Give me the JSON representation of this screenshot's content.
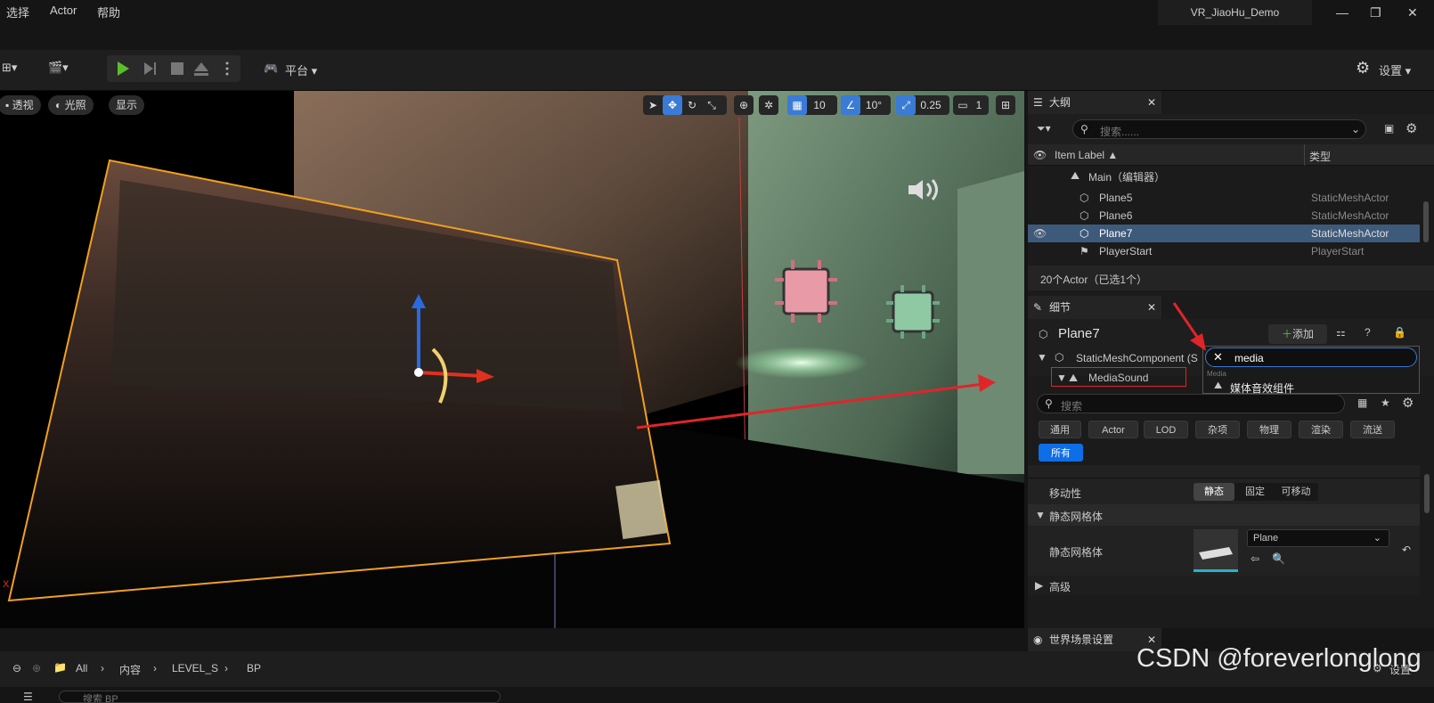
{
  "menu": [
    "选择",
    "Actor",
    "帮助"
  ],
  "project_name": "VR_JiaoHu_Demo",
  "toolbar": {
    "platform_label": "平台",
    "settings_label": "设置"
  },
  "viewport": {
    "view_mode": "透视",
    "lighting": "光照",
    "show": "显示",
    "grid_snap": "10",
    "rotation_snap": "10°",
    "scale_snap": "0.25",
    "camera_speed": "1",
    "axis_label": "X"
  },
  "outliner": {
    "tab_title": "大纲",
    "search_placeholder": "搜索......",
    "col_label": "Item Label ▲",
    "col_type": "类型",
    "level_row": "Main（编辑器）",
    "rows": [
      {
        "label": "Plane5",
        "type": "StaticMeshActor"
      },
      {
        "label": "Plane6",
        "type": "StaticMeshActor"
      },
      {
        "label": "Plane7",
        "type": "StaticMeshActor"
      },
      {
        "label": "PlayerStart",
        "type": "PlayerStart"
      }
    ],
    "status": "20个Actor（已选1个）"
  },
  "details": {
    "tab_title": "细节",
    "actor_name": "Plane7",
    "add_label": "添加",
    "component_root": "StaticMeshComponent (S",
    "component_child": "MediaSound",
    "popup_query": "media",
    "popup_category": "Media",
    "popup_item": "媒体音效组件",
    "search_placeholder": "搜索",
    "categories": [
      "通用",
      "Actor",
      "LOD",
      "杂项",
      "物理",
      "渲染",
      "流送"
    ],
    "all_label": "所有",
    "mobility_label": "移动性",
    "mobility_options": [
      "静态",
      "固定",
      "可移动"
    ],
    "section_mesh": "静态网格体",
    "mesh_prop_label": "静态网格体",
    "mesh_value": "Plane",
    "advanced_label": "高级"
  },
  "world_settings_tab": "世界场景设置",
  "breadcrumb": [
    "All",
    "内容",
    "LEVEL_S",
    "BP"
  ],
  "content_search_placeholder": "搜索 BP",
  "bottom_settings": "设置",
  "watermark": "CSDN @foreverlonglong",
  "colors": {
    "accent": "#3a7bd5",
    "selection_outline": "#f0a020",
    "annotation": "#e0252a",
    "play": "#5cbf2a"
  }
}
